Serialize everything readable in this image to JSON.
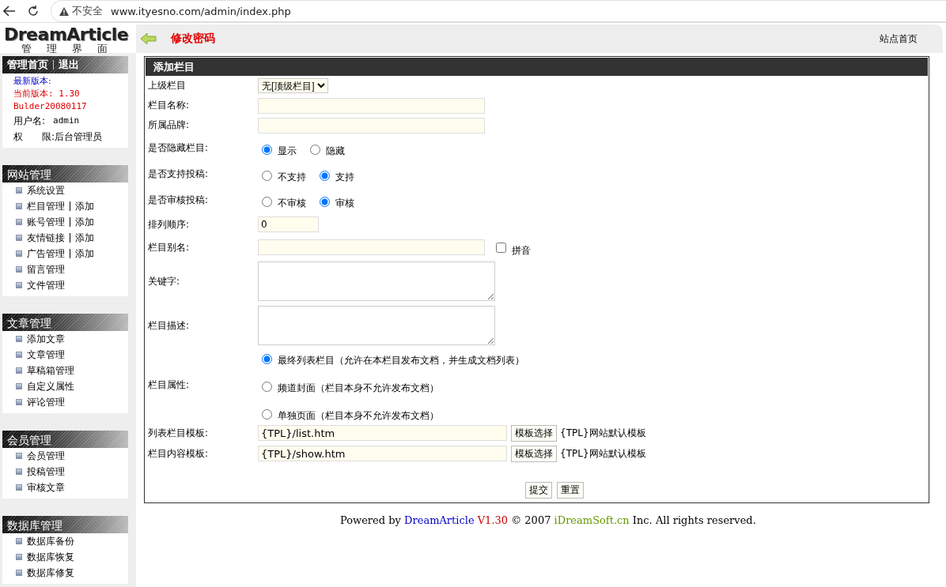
{
  "browser": {
    "security": "不安全",
    "url": "www.ityesno.com/admin/index.php"
  },
  "header": {
    "logo": "DreamArticle",
    "logo_subtitle": "管理界面",
    "change_password": "修改密码",
    "site_home": "站点首页"
  },
  "sidebar": {
    "top_links": [
      "管理首页",
      "退出"
    ],
    "latest_version": "最新版本:",
    "current_version": "当前版本: 1.30",
    "build": "Bulder20080117",
    "username_label": "用户名:",
    "username": "admin",
    "role_label": "权　　限:",
    "role": "后台管理员",
    "sections": [
      {
        "title": "网站管理",
        "items": [
          {
            "label": "系统设置"
          },
          {
            "label": "栏目管理",
            "add": "添加"
          },
          {
            "label": "账号管理",
            "add": "添加"
          },
          {
            "label": "友情链接",
            "add": "添加"
          },
          {
            "label": "广告管理",
            "add": "添加"
          },
          {
            "label": "留言管理"
          },
          {
            "label": "文件管理"
          }
        ]
      },
      {
        "title": "文章管理",
        "items": [
          {
            "label": "添加文章"
          },
          {
            "label": "文章管理"
          },
          {
            "label": "草稿箱管理"
          },
          {
            "label": "自定义属性"
          },
          {
            "label": "评论管理"
          }
        ]
      },
      {
        "title": "会员管理",
        "items": [
          {
            "label": "会员管理"
          },
          {
            "label": "投稿管理"
          },
          {
            "label": "审核文章"
          }
        ]
      },
      {
        "title": "数据库管理",
        "items": [
          {
            "label": "数据库备份"
          },
          {
            "label": "数据库恢复"
          },
          {
            "label": "数据库修复"
          }
        ]
      }
    ]
  },
  "form": {
    "title": "添加栏目",
    "fields": [
      {
        "kind": "select",
        "label": "上级栏目",
        "value": "无[顶级栏目]"
      },
      {
        "kind": "text",
        "label": "栏目名称:"
      },
      {
        "kind": "text",
        "label": "所属品牌:"
      },
      {
        "kind": "radio",
        "label": "是否隐藏栏目:",
        "options": [
          {
            "label": "显示",
            "selected": true
          },
          {
            "label": "隐藏",
            "selected": false
          }
        ]
      },
      {
        "kind": "radio",
        "label": "是否支持投稿:",
        "options": [
          {
            "label": "不支持",
            "selected": false
          },
          {
            "label": "支持",
            "selected": true
          }
        ]
      },
      {
        "kind": "radio",
        "label": "是否审核投稿:",
        "options": [
          {
            "label": "不审核",
            "selected": false
          },
          {
            "label": "审核",
            "selected": true
          }
        ]
      },
      {
        "kind": "short",
        "label": "排列顺序:",
        "value": "0"
      },
      {
        "kind": "text_check",
        "label": "栏目别名:",
        "checkbox": {
          "label": "拼音",
          "checked": false
        }
      },
      {
        "kind": "textarea",
        "label": "关键字:"
      },
      {
        "kind": "textarea",
        "label": "栏目描述:"
      },
      {
        "kind": "radio_stack",
        "label": "栏目属性:",
        "options": [
          {
            "label": "最终列表栏目（允许在本栏目发布文档，并生成文档列表）",
            "selected": true
          },
          {
            "label": "频道封面（栏目本身不允许发布文档）",
            "selected": false
          },
          {
            "label": "单独页面（栏目本身不允许发布文档）",
            "selected": false
          }
        ]
      },
      {
        "kind": "template",
        "label": "列表栏目模板:",
        "value": "{TPL}/list.htm",
        "button": "模板选择",
        "hint": "{TPL}网站默认模板"
      },
      {
        "kind": "template",
        "label": "栏目内容模板:",
        "value": "{TPL}/show.htm",
        "button": "模板选择",
        "hint": "{TPL}网站默认模板"
      }
    ],
    "buttons": [
      "提交",
      "重置"
    ]
  },
  "footer": [
    {
      "kind": "text",
      "text": "Powered by"
    },
    {
      "kind": "link",
      "text": "DreamArticle",
      "color": "#0000cc"
    },
    {
      "kind": "link",
      "text": "V1.30",
      "color": "#cc0000"
    },
    {
      "kind": "text",
      "text": "© 2007"
    },
    {
      "kind": "link",
      "text": "iDreamSoft.cn",
      "color": "#669900"
    },
    {
      "kind": "text",
      "text": "Inc. All rights reserved."
    }
  ]
}
